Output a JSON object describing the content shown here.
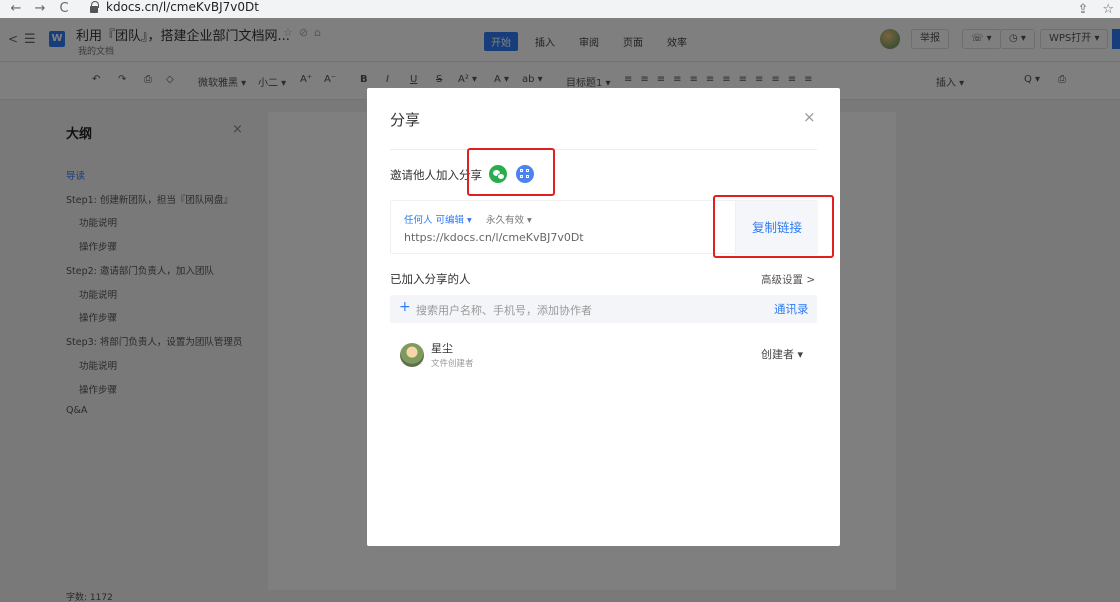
{
  "browser": {
    "nav_back": "←",
    "nav_forward": "→",
    "nav_reload": "C",
    "url": "kdocs.cn/l/cmeKvBJ7v0Dt",
    "share_icon": "⇪",
    "star_icon": "☆"
  },
  "app": {
    "back": "<",
    "menu": "☰",
    "logo": "W",
    "doc_title": "利用『团队』，搭建企业部门文档网...",
    "doc_sub": "我的文档",
    "tabs": [
      {
        "label": "开始",
        "active": true
      },
      {
        "label": "插入",
        "active": false
      },
      {
        "label": "审阅",
        "active": false
      },
      {
        "label": "页面",
        "active": false
      },
      {
        "label": "效率",
        "active": false
      }
    ],
    "report": "举报",
    "share_btn": "☏ ▾",
    "history_btn": "◷ ▾",
    "wps_open": "WPS打开 ▾"
  },
  "toolbar": {
    "undo": "↶",
    "redo": "↷",
    "format_painter": "⎙",
    "clear": "◇",
    "font_name": "微软雅黑 ▾",
    "font_size": "小二 ▾",
    "grow": "A⁺",
    "shrink": "A⁻",
    "bold": "B",
    "italic": "I",
    "underline": "U",
    "strike": "S",
    "superscript": "A² ▾",
    "font_color": "A ▾",
    "highlight": "ab ▾",
    "heading": "目标题1 ▾",
    "insert": "插入 ▾",
    "find": "Q ▾",
    "print": "⎙"
  },
  "outline": {
    "title": "大纲",
    "close": "×",
    "items": [
      {
        "label": "导读",
        "active": true
      },
      {
        "label": "Step1: 创建新团队，担当『团队网盘』",
        "active": false
      },
      {
        "label": "功能说明",
        "active": false
      },
      {
        "label": "操作步骤",
        "active": false
      },
      {
        "label": "Step2: 邀请部门负责人，加入团队",
        "active": false
      },
      {
        "label": "功能说明",
        "active": false
      },
      {
        "label": "操作步骤",
        "active": false
      },
      {
        "label": "Step3: 将部门负责人，设置为团队管理员",
        "active": false
      },
      {
        "label": "功能说明",
        "active": false
      },
      {
        "label": "操作步骤",
        "active": false
      },
      {
        "label": "Q&A",
        "active": false
      }
    ]
  },
  "status": {
    "words": "字数: 1172"
  },
  "modal": {
    "title": "分享",
    "close": "×",
    "invite_label": "邀请他人加入分享",
    "link_permission": "任何人 可编辑 ▾",
    "link_expire": "永久有效 ▾",
    "link_url": "https://kdocs.cn/l/cmeKvBJ7v0Dt",
    "copy_link": "复制链接",
    "joined_label": "已加入分享的人",
    "advanced": "高级设置 >",
    "search_plus": "+",
    "search_placeholder": "搜索用户名称、手机号，添加协作者",
    "contacts": "通讯录",
    "member": {
      "name": "星尘",
      "role": "文件创建者",
      "permission": "创建者 ▾"
    }
  },
  "colors": {
    "accent": "#2e7cf6",
    "highlight": "#e02020",
    "wechat": "#2bad4e"
  }
}
